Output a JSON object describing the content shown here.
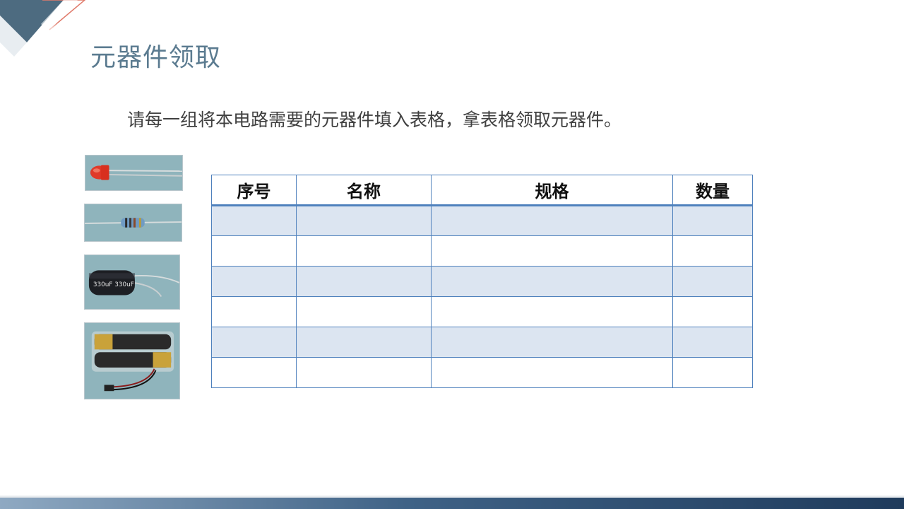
{
  "slide": {
    "title": "元器件领取",
    "instruction": "请每一组将本电路需要的元器件填入表格，拿表格领取元器件。"
  },
  "photos": {
    "capacitor_label": "330uF 330uF",
    "items": [
      {
        "name": "led-photo"
      },
      {
        "name": "resistor-photo"
      },
      {
        "name": "capacitor-photo"
      },
      {
        "name": "battery-holder-photo"
      }
    ]
  },
  "table": {
    "headers": [
      "序号",
      "名称",
      "规格",
      "数量"
    ],
    "rows": [
      [
        "",
        "",
        "",
        ""
      ],
      [
        "",
        "",
        "",
        ""
      ],
      [
        "",
        "",
        "",
        ""
      ],
      [
        "",
        "",
        "",
        ""
      ],
      [
        "",
        "",
        "",
        ""
      ],
      [
        "",
        "",
        "",
        ""
      ]
    ]
  },
  "colors": {
    "title": "#5b7b90",
    "table_border": "#4f81bd",
    "table_band": "#dce5f1",
    "accent_dark": "#1f3b5c"
  }
}
